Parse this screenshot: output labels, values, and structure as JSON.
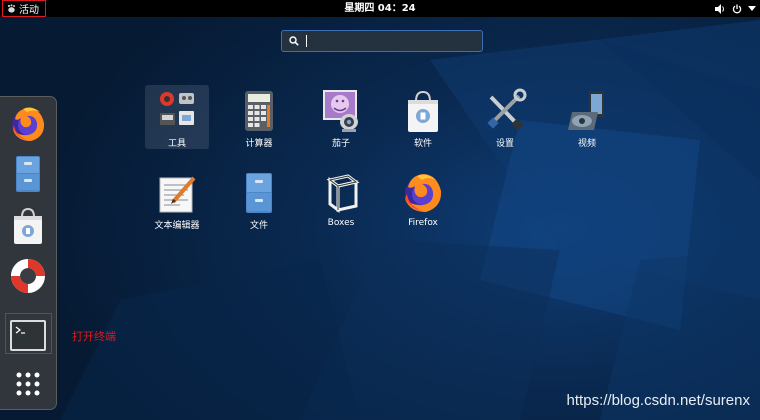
{
  "topbar": {
    "activities_label": "活动",
    "clock": "星期四 04：24"
  },
  "search": {
    "value": "",
    "placeholder": ""
  },
  "dash": {
    "items": [
      {
        "name": "firefox"
      },
      {
        "name": "files"
      },
      {
        "name": "software"
      },
      {
        "name": "help"
      },
      {
        "name": "terminal"
      },
      {
        "name": "show-applications"
      }
    ],
    "annotation": "打开终端"
  },
  "apps": [
    {
      "label": "工具",
      "icon": "utilities-icon"
    },
    {
      "label": "计算器",
      "icon": "calculator-icon"
    },
    {
      "label": "茄子",
      "icon": "cheese-icon"
    },
    {
      "label": "软件",
      "icon": "software-bag-icon"
    },
    {
      "label": "设置",
      "icon": "settings-tools-icon"
    },
    {
      "label": "视频",
      "icon": "video-icon"
    },
    {
      "label": "文本编辑器",
      "icon": "text-editor-icon"
    },
    {
      "label": "文件",
      "icon": "file-cabinet-icon"
    },
    {
      "label": "Boxes",
      "icon": "boxes-cube-icon"
    },
    {
      "label": "Firefox",
      "icon": "firefox-icon"
    }
  ],
  "watermark": "https://blog.csdn.net/surenx",
  "colors": {
    "highlight_red": "#e0191e",
    "search_border": "#3d6fb6",
    "background": "#0a2a52"
  }
}
